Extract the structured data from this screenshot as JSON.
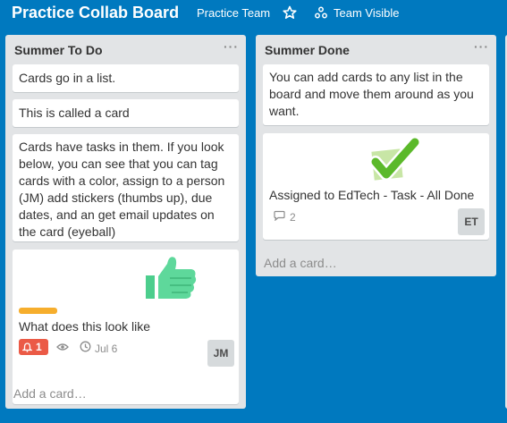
{
  "header": {
    "title": "Practice Collab Board",
    "team": "Practice Team",
    "visibility": "Team Visible"
  },
  "lists": [
    {
      "title": "Summer To Do",
      "menu": "···",
      "cards": [
        {
          "text": "Cards go in a list."
        },
        {
          "text": "This is called a card"
        },
        {
          "text_lines": [
            "Cards have tasks in them. If you look",
            "below, you can see that you can tag",
            "cards with a color, assign to a person",
            "(JM) add stickers (thumbs up), due",
            "dates, and an get email updates on",
            "the card (eyeball)"
          ]
        },
        {
          "text": "What does this look like",
          "sticker": "thumbs-up-icon",
          "label_color": "#f6ae2d",
          "notifications": "1",
          "due": "Jul 6",
          "member": "JM"
        }
      ],
      "add_card": "Add a card…"
    },
    {
      "title": "Summer Done",
      "menu": "···",
      "cards": [
        {
          "text_lines": [
            "You can add cards to any list in the",
            "board and move them around as you",
            "want."
          ]
        },
        {
          "text": "Assigned to EdTech - Task - All Done",
          "sticker": "checkmark-icon",
          "comments": "2",
          "member": "ET"
        }
      ],
      "add_card": "Add a card…"
    }
  ]
}
